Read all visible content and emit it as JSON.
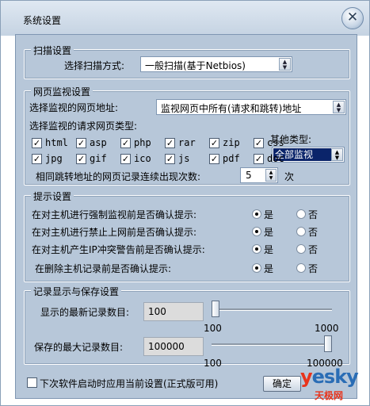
{
  "window": {
    "title": "系统设置",
    "close_glyph": "✕"
  },
  "scan": {
    "legend": "扫描设置",
    "label": "选择扫描方式:",
    "method_value": "一般扫描(基于Netbios)"
  },
  "web": {
    "legend": "网页监视设置",
    "address_label": "选择监视的网页地址:",
    "address_value": "监视网页中所有(请求和跳转)地址",
    "types_label": "选择监视的请求网页类型:",
    "types": [
      {
        "label": "html",
        "checked": true
      },
      {
        "label": "asp",
        "checked": true
      },
      {
        "label": "php",
        "checked": true
      },
      {
        "label": "rar",
        "checked": true
      },
      {
        "label": "zip",
        "checked": true
      },
      {
        "label": "css",
        "checked": true
      },
      {
        "label": "jpg",
        "checked": true
      },
      {
        "label": "gif",
        "checked": true
      },
      {
        "label": "ico",
        "checked": true
      },
      {
        "label": "js",
        "checked": true
      },
      {
        "label": "pdf",
        "checked": true
      },
      {
        "label": "doc",
        "checked": true
      }
    ],
    "other_label": "其他类型:",
    "other_value": "全部监视",
    "redirect_label": "相同跳转地址的网页记录连续出现次数:",
    "redirect_value": "5",
    "redirect_unit": "次"
  },
  "prompt": {
    "legend": "提示设置",
    "yes": "是",
    "no": "否",
    "rows": [
      {
        "text": "在对主机进行强制监视前是否确认提示:",
        "selected": "yes"
      },
      {
        "text": "在对主机进行禁止上网前是否确认提示:",
        "selected": "yes"
      },
      {
        "text": "在对主机产生IP冲突警告前是否确认提示:",
        "selected": "yes"
      },
      {
        "text": "在删除主机记录前是否确认提示:",
        "selected": "yes"
      }
    ]
  },
  "records": {
    "legend": "记录显示与保存设置",
    "latest_label": "显示的最新记录数目:",
    "latest_value": "100",
    "latest_min": "100",
    "latest_max": "1000",
    "latest_level": 0,
    "max_label": "保存的最大记录数目:",
    "max_value": "100000",
    "max_min": "100",
    "max_max": "100000",
    "max_level": 1
  },
  "footer": {
    "apply_label": "下次软件启动时应用当前设置(正式版可用)",
    "ok_label": "确定"
  },
  "logo": {
    "y": "y",
    "rest": "esky",
    "sub": "天极网"
  },
  "colors": {
    "panel": "#b7c7d9",
    "title_bar": "#c5d3e2",
    "selection": "#0a246a",
    "logo_blue": "#2a6db5",
    "logo_red": "#e8341c"
  }
}
